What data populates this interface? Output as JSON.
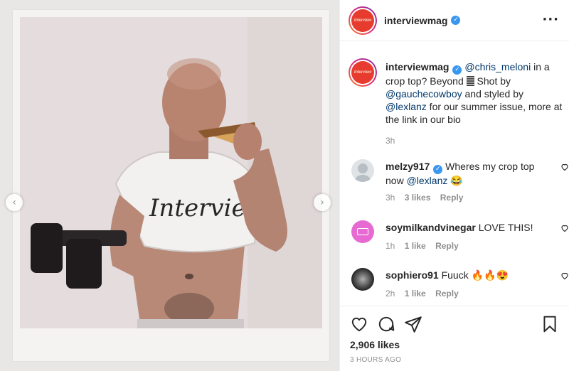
{
  "post": {
    "username": "interviewmag",
    "avatar_text": "Interview",
    "nav": {
      "prev_icon": "chevron-left-icon",
      "next_icon": "chevron-right-icon"
    },
    "photo": {
      "shirt_text": "Interview"
    }
  },
  "caption": {
    "username": "interviewmag",
    "mention1": "@chris_meloni",
    "text1": " in a crop top? Beyond ",
    "text2": " Shot by ",
    "mention2": "@gauchecowboy",
    "text3": " and styled by ",
    "mention3": "@lexlanz",
    "text4": " for our summer issue, more at the link in our bio",
    "time": "3h"
  },
  "comments": [
    {
      "username": "melzy917",
      "verified": true,
      "text": "Wheres my crop top now ",
      "mention": "@lexlanz",
      "emoji": "😂",
      "time": "3h",
      "likes": "3 likes",
      "reply": "Reply"
    },
    {
      "username": "soymilkandvinegar",
      "text": "LOVE THIS!",
      "time": "1h",
      "likes": "1 like",
      "reply": "Reply"
    },
    {
      "username": "sophiero91",
      "text": "Fuuck ",
      "emoji": "🔥🔥😍",
      "time": "2h",
      "likes": "1 like",
      "reply": "Reply"
    }
  ],
  "footer": {
    "likes": "2,906 likes",
    "time_ago": "3 HOURS AGO"
  },
  "colors": {
    "verified": "#3897f0",
    "mention": "#00376b",
    "meta": "#8e8e8e",
    "brand_red": "#e63b2e"
  }
}
